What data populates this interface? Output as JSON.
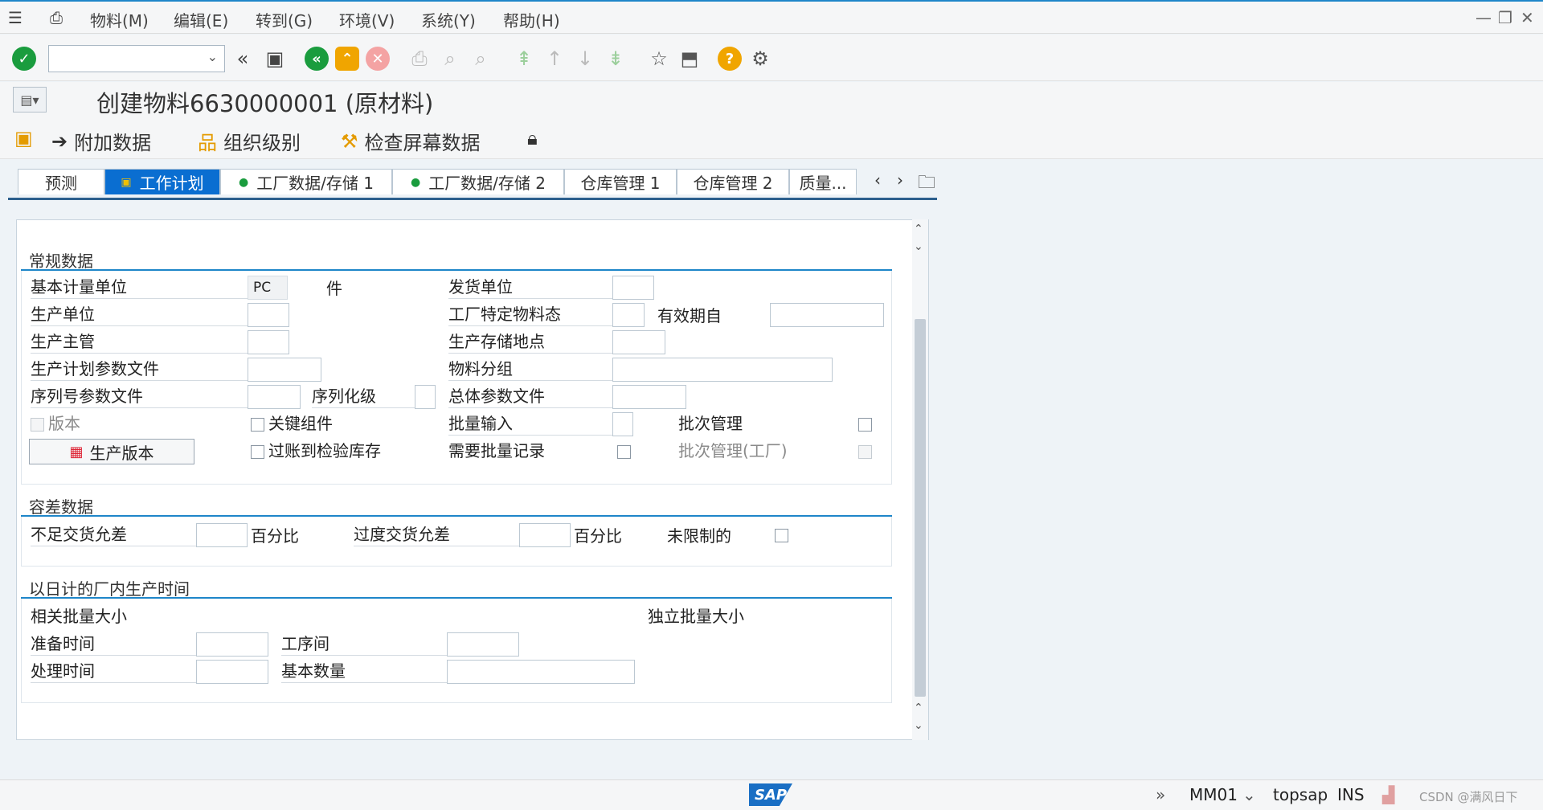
{
  "menu": {
    "items": [
      "物料(M)",
      "编辑(E)",
      "转到(G)",
      "环境(V)",
      "系统(Y)",
      "帮助(H)"
    ]
  },
  "title": "创建物料6630000001 (原材料)",
  "app_toolbar": {
    "additional_data": "附加数据",
    "org_levels": "组织级别",
    "check_screen": "检查屏幕数据"
  },
  "tabs": [
    "预测",
    "工作计划",
    "工厂数据/存储 1",
    "工厂数据/存储 2",
    "仓库管理 1",
    "仓库管理 2",
    "质量..."
  ],
  "general": {
    "title": "常规数据",
    "base_uom_label": "基本计量单位",
    "base_uom_value": "PC",
    "base_uom_text": "件",
    "issue_unit_label": "发货单位",
    "prod_unit_label": "生产单位",
    "plant_status_label": "工厂特定物料态",
    "valid_from_label": "有效期自",
    "prod_supervisor_label": "生产主管",
    "prod_storage_label": "生产存储地点",
    "prod_profile_label": "生产计划参数文件",
    "material_group_label": "物料分组",
    "serial_profile_label": "序列号参数文件",
    "serialization_label": "序列化级",
    "overall_profile_label": "总体参数文件",
    "version_label": "版本",
    "critical_part_label": "关键组件",
    "batch_entry_label": "批量输入",
    "batch_mgmt_label": "批次管理",
    "prod_version_button": "生产版本",
    "post_inspection_label": "过账到检验库存",
    "batch_record_label": "需要批量记录",
    "batch_mgmt_plant_label": "批次管理(工厂)"
  },
  "tolerance": {
    "title": "容差数据",
    "under_label": "不足交货允差",
    "pct1": "百分比",
    "over_label": "过度交货允差",
    "pct2": "百分比",
    "unlimited_label": "未限制的"
  },
  "inhouse": {
    "title": "以日计的厂内生产时间",
    "lot_dep_label": "相关批量大小",
    "lot_indep_label": "独立批量大小",
    "setup_label": "准备时间",
    "interop_label": "工序间",
    "proc_label": "处理时间",
    "base_qty_label": "基本数量"
  },
  "status": {
    "tcode": "MM01",
    "server": "topsap",
    "mode": "INS",
    "watermark": "CSDN @满风日下",
    "logo": "SAP"
  }
}
